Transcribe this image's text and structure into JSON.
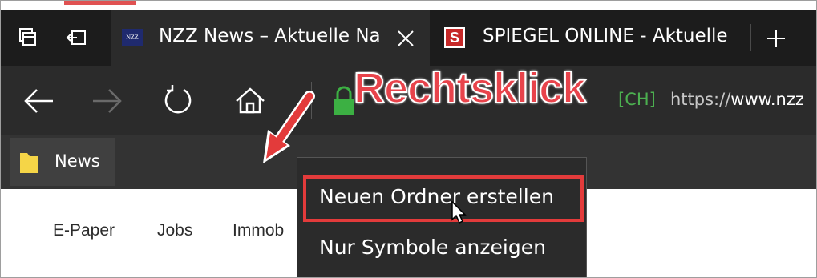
{
  "tabs": [
    {
      "favicon_text": "NZZ",
      "title": "NZZ News – Aktuelle Na",
      "active": true
    },
    {
      "favicon_text": "S",
      "title": "SPIEGEL ONLINE - Aktuelle",
      "active": false
    }
  ],
  "toolbar_icons": {
    "tab_preview": "tab-preview-icon",
    "set_aside": "set-aside-tabs-icon",
    "close_tab": "close-icon",
    "new_tab": "plus-icon"
  },
  "nav_icons": [
    "back-arrow-icon",
    "forward-arrow-icon",
    "refresh-icon",
    "home-icon",
    "lock-icon"
  ],
  "address": {
    "cert_label": "[CH]",
    "url_scheme": "https://",
    "url_host": "www.nzz"
  },
  "favorites": {
    "items": [
      {
        "label": "News",
        "icon": "folder-icon"
      }
    ]
  },
  "page_nav": [
    {
      "label": "E-Paper"
    },
    {
      "label": "Jobs"
    },
    {
      "label": "Immob"
    }
  ],
  "context_menu": {
    "items": [
      {
        "label": "Neuen Ordner erstellen",
        "highlighted": true
      },
      {
        "label": "Nur Symbole anzeigen",
        "highlighted": false
      }
    ]
  },
  "annotation": {
    "text": "Rechtsklick",
    "color": "#e8434b"
  },
  "colors": {
    "tabbar_bg": "#1c1c1c",
    "toolbar_bg": "#2b2b2b",
    "favbar_bg": "#333333",
    "highlight_border": "#e33b3b",
    "lock_green": "#3cb043",
    "cert_green": "#4caf50"
  }
}
